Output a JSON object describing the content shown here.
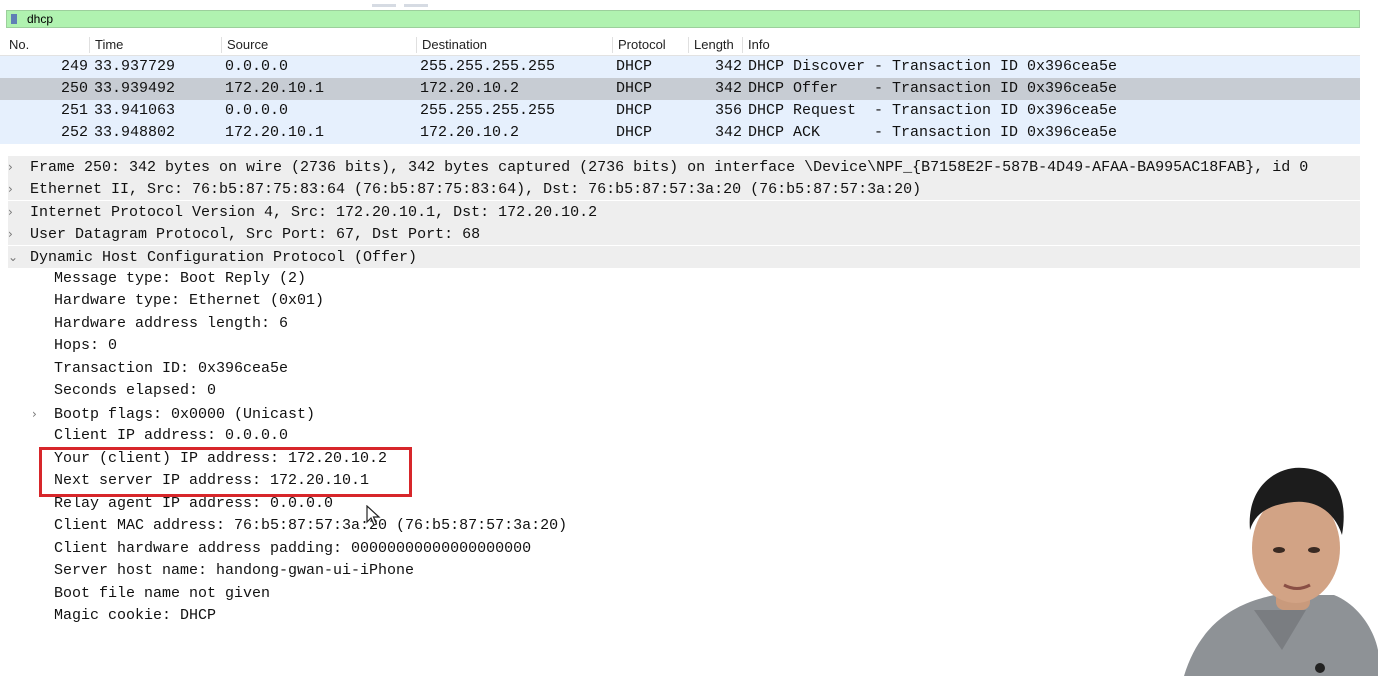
{
  "filter": {
    "value": "dhcp"
  },
  "columns": [
    "No.",
    "Time",
    "Source",
    "Destination",
    "Protocol",
    "Length",
    "Info"
  ],
  "packets": [
    {
      "no": "249",
      "time": "33.937729",
      "source": "0.0.0.0",
      "destination": "255.255.255.255",
      "protocol": "DHCP",
      "length": "342",
      "info": "DHCP Discover - Transaction ID 0x396cea5e"
    },
    {
      "no": "250",
      "time": "33.939492",
      "source": "172.20.10.1",
      "destination": "172.20.10.2",
      "protocol": "DHCP",
      "length": "342",
      "info": "DHCP Offer    - Transaction ID 0x396cea5e"
    },
    {
      "no": "251",
      "time": "33.941063",
      "source": "0.0.0.0",
      "destination": "255.255.255.255",
      "protocol": "DHCP",
      "length": "356",
      "info": "DHCP Request  - Transaction ID 0x396cea5e"
    },
    {
      "no": "252",
      "time": "33.948802",
      "source": "172.20.10.1",
      "destination": "172.20.10.2",
      "protocol": "DHCP",
      "length": "342",
      "info": "DHCP ACK      - Transaction ID 0x396cea5e"
    }
  ],
  "selected_packet": "250",
  "summaries": [
    "Frame 250: 342 bytes on wire (2736 bits), 342 bytes captured (2736 bits) on interface \\Device\\NPF_{B7158E2F-587B-4D49-AFAA-BA995AC18FAB}, id 0",
    "Ethernet II, Src: 76:b5:87:75:83:64 (76:b5:87:75:83:64), Dst: 76:b5:87:57:3a:20 (76:b5:87:57:3a:20)",
    "Internet Protocol Version 4, Src: 172.20.10.1, Dst: 172.20.10.2",
    "User Datagram Protocol, Src Port: 67, Dst Port: 68",
    "Dynamic Host Configuration Protocol (Offer)"
  ],
  "dhcp_fields": [
    "Message type: Boot Reply (2)",
    "Hardware type: Ethernet (0x01)",
    "Hardware address length: 6",
    "Hops: 0",
    "Transaction ID: 0x396cea5e",
    "Seconds elapsed: 0",
    "Bootp flags: 0x0000 (Unicast)",
    "Client IP address: 0.0.0.0",
    "Your (client) IP address: 172.20.10.2",
    "Next server IP address: 172.20.10.1",
    "Relay agent IP address: 0.0.0.0",
    "Client MAC address: 76:b5:87:57:3a:20 (76:b5:87:57:3a:20)",
    "Client hardware address padding: 00000000000000000000",
    "Server host name: handong-gwan-ui-iPhone",
    "Boot file name not given",
    "Magic cookie: DHCP"
  ],
  "colors": {
    "filter_bg": "#b0f2b0",
    "row_bg": "#e6f0fd",
    "selected_row_bg": "#c7ccd3",
    "highlight_box": "#d7262a"
  }
}
